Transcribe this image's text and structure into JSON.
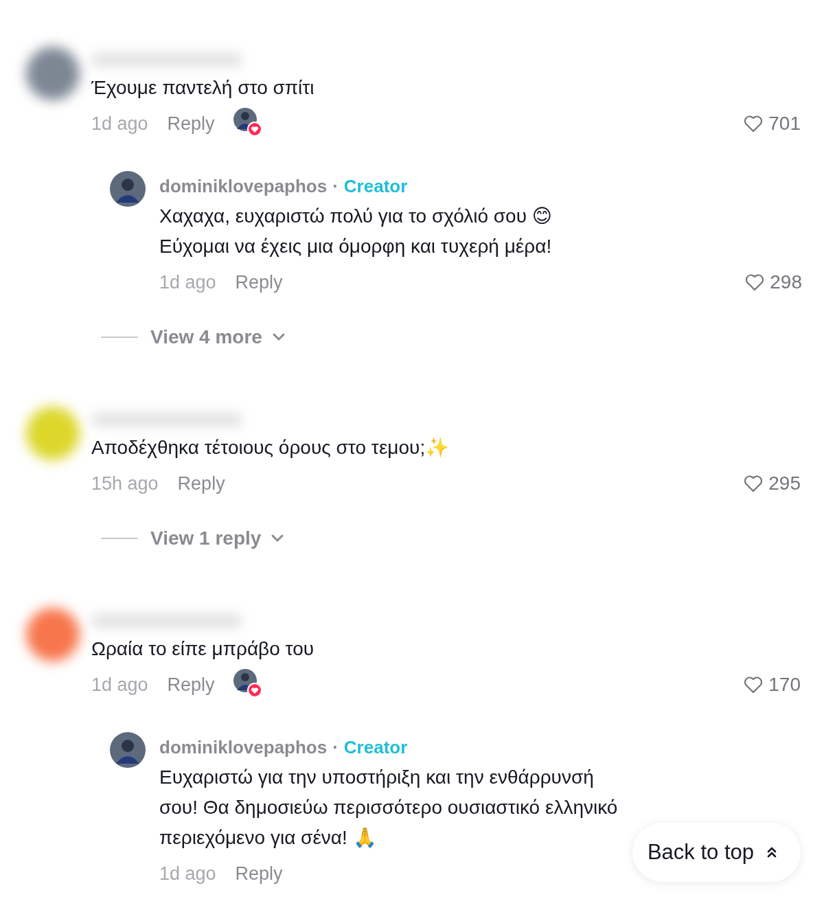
{
  "comments": [
    {
      "color": "#7d8794",
      "text": "Έχουμε παντελή στο σπίτι",
      "time": "1d ago",
      "reply_label": "Reply",
      "liked_by_creator": true,
      "likes": "701",
      "replies": [
        {
          "author": "dominiklovepaphos",
          "separator": "·",
          "badge": "Creator",
          "text": "Χαχαχα, ευχαριστώ πολύ για το σχόλιό σου 😊\nΕύχομαι να έχεις μια όμορφη και τυχερή μέρα!",
          "time": "1d ago",
          "reply_label": "Reply",
          "likes": "298"
        }
      ],
      "more": "View 4 more"
    },
    {
      "color": "#dcd72a",
      "text": "Αποδέχθηκα τέτοιους όρους στο τεμου;✨",
      "time": "15h ago",
      "reply_label": "Reply",
      "liked_by_creator": false,
      "likes": "295",
      "more": "View 1 reply"
    },
    {
      "color": "#f7764c",
      "text": "Ωραία το είπε μπράβο του",
      "time": "1d ago",
      "reply_label": "Reply",
      "liked_by_creator": true,
      "likes": "170",
      "replies": [
        {
          "author": "dominiklovepaphos",
          "separator": "·",
          "badge": "Creator",
          "text": "Ευχαριστώ για την υποστήριξη και την ενθάρρυνσή\nσου! Θα δημοσιεύω περισσότερο ουσιαστικό ελληνικό\nπεριεχόμενο για σένα! 🙏",
          "time": "1d ago",
          "reply_label": "Reply"
        }
      ]
    }
  ],
  "back_to_top": "Back to top"
}
